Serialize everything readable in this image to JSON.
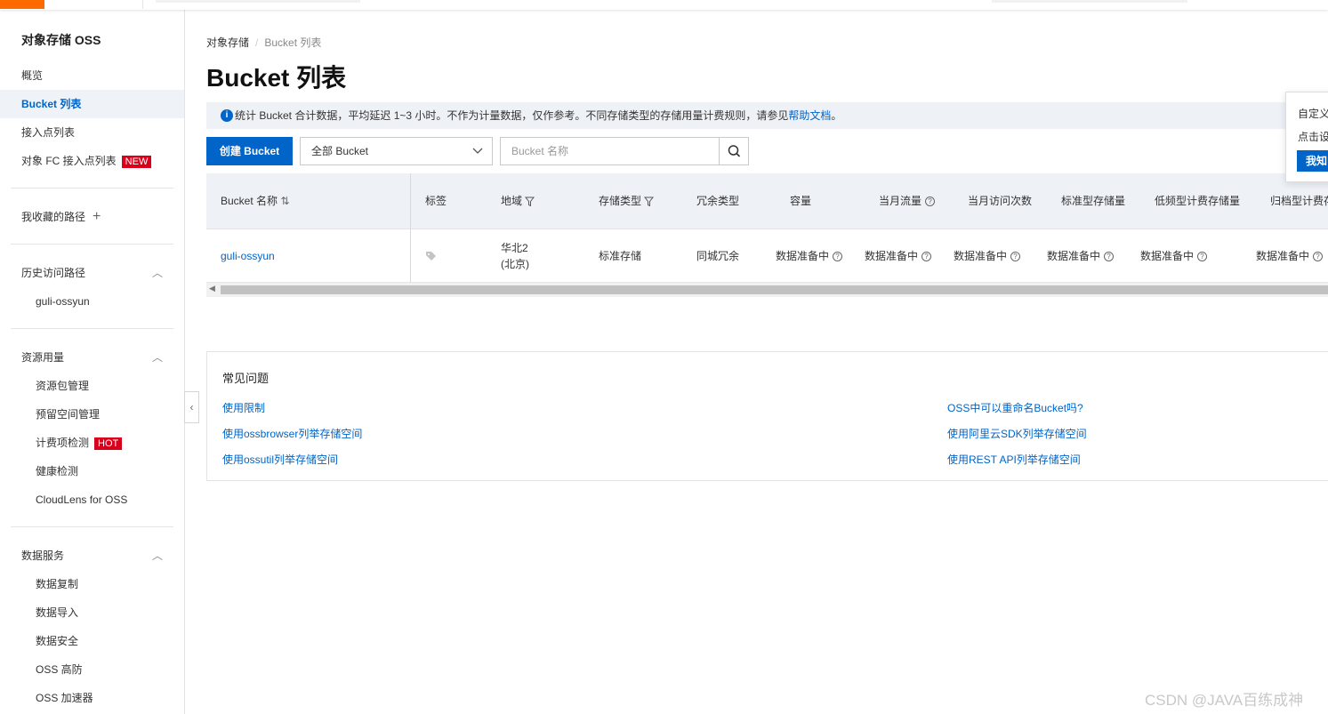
{
  "sidebar": {
    "title": "对象存储 OSS",
    "items": [
      {
        "label": "概览"
      },
      {
        "label": "Bucket 列表"
      },
      {
        "label": "接入点列表"
      },
      {
        "label": "对象 FC 接入点列表",
        "badge": "NEW"
      }
    ],
    "favorites_label": "我收藏的路径",
    "history_label": "历史访问路径",
    "history_items": [
      "guli-ossyun"
    ],
    "resource_label": "资源用量",
    "resource_items": [
      {
        "label": "资源包管理"
      },
      {
        "label": "预留空间管理"
      },
      {
        "label": "计费项检测",
        "badge": "HOT"
      },
      {
        "label": "健康检测"
      },
      {
        "label": "CloudLens for OSS"
      }
    ],
    "data_service_label": "数据服务",
    "data_service_items": [
      "数据复制",
      "数据导入",
      "数据安全",
      "OSS 高防",
      "OSS 加速器"
    ]
  },
  "breadcrumb": {
    "root": "对象存储",
    "current": "Bucket 列表"
  },
  "page_title": "Bucket 列表",
  "notice": {
    "text": "统计 Bucket 合计数据，平均延迟 1~3 小时。不作为计量数据，仅作参考。不同存储类型的存储用量计费规则，请参见",
    "link": "帮助文档",
    "tail": "。"
  },
  "toolbar": {
    "create_label": "创建 Bucket",
    "select_value": "全部 Bucket",
    "search_placeholder": "Bucket 名称"
  },
  "table": {
    "headers": {
      "name": "Bucket 名称",
      "tags": "标签",
      "region": "地域",
      "storage_class": "存储类型",
      "redundancy": "冗余类型",
      "capacity": "容量",
      "traffic": "当月流量",
      "requests": "当月访问次数",
      "standard": "标准型存储量",
      "ia": "低频型计费存储量",
      "archive": "归档型计费存"
    },
    "rows": [
      {
        "name": "guli-ossyun",
        "region_line1": "华北2",
        "region_line2": "(北京)",
        "storage_class": "标准存储",
        "redundancy": "同城冗余",
        "capacity": "数据准备中",
        "traffic": "数据准备中",
        "requests": "数据准备中",
        "standard": "数据准备中",
        "ia": "数据准备中",
        "archive": "数据准备中"
      }
    ]
  },
  "faq": {
    "title": "常见问题",
    "left": [
      "使用限制",
      "使用ossbrowser列举存储空间",
      "使用ossutil列举存储空间"
    ],
    "right": [
      "OSS中可以重命名Bucket吗?",
      "使用阿里云SDK列举存储空间",
      "使用REST API列举存储空间"
    ]
  },
  "popover": {
    "line1": "自定义",
    "line2": "点击设",
    "button": "我知"
  },
  "watermark": "CSDN @JAVA百练成神",
  "colors": {
    "accent": "#0064c8",
    "brand": "#ff6a00",
    "badge": "#d9001b"
  }
}
